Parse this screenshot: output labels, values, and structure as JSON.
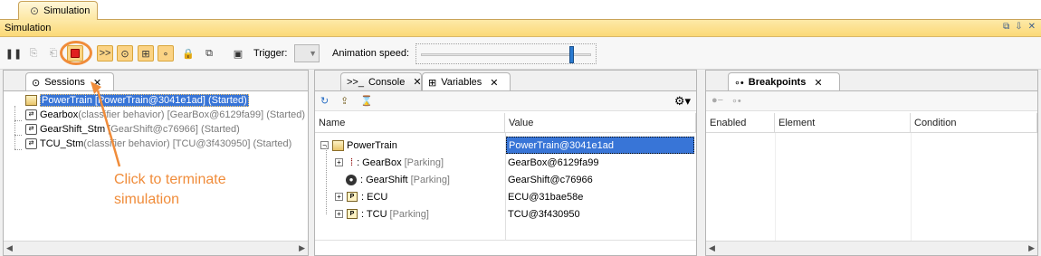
{
  "top_tab": {
    "label": "Simulation"
  },
  "window": {
    "title": "Simulation",
    "btn1": "⧉",
    "btn2": "⇩",
    "btn3": "✕"
  },
  "toolbar": {
    "trigger_label": "Trigger:",
    "animation_label": "Animation speed:",
    "animation_speed": 0.88
  },
  "sessions": {
    "tab_label": "Sessions",
    "items": [
      {
        "name": "PowerTrain [PowerTrain@3041e1ad] (Started)",
        "selected": true
      },
      {
        "name": "Gearbox",
        "extra": "(classifier behavior) [GearBox@6129fa99] (Started)"
      },
      {
        "name": "GearShift_Stm",
        "extra": "[GearShift@c76966] (Started)"
      },
      {
        "name": "TCU_Stm",
        "extra": "(classifier behavior) [TCU@3f430950] (Started)"
      }
    ]
  },
  "annotation": {
    "text": "Click to terminate simulation"
  },
  "variables": {
    "console_tab": "Console",
    "variables_tab": "Variables",
    "columns": [
      "Name",
      "Value"
    ],
    "rows": [
      {
        "name": "PowerTrain",
        "state": "",
        "value": "PowerTrain@3041e1ad"
      },
      {
        "name": ": GearBox",
        "state": "[Parking]",
        "value": "GearBox@6129fa99"
      },
      {
        "name": ": GearShift",
        "state": "[Parking]",
        "value": "GearShift@c76966"
      },
      {
        "name": ": ECU",
        "state": "",
        "value": "ECU@31bae58e"
      },
      {
        "name": ": TCU",
        "state": "[Parking]",
        "value": "TCU@3f430950"
      }
    ]
  },
  "breakpoints": {
    "tab_label": "Breakpoints",
    "columns": [
      "Enabled",
      "Element",
      "Condition"
    ]
  }
}
